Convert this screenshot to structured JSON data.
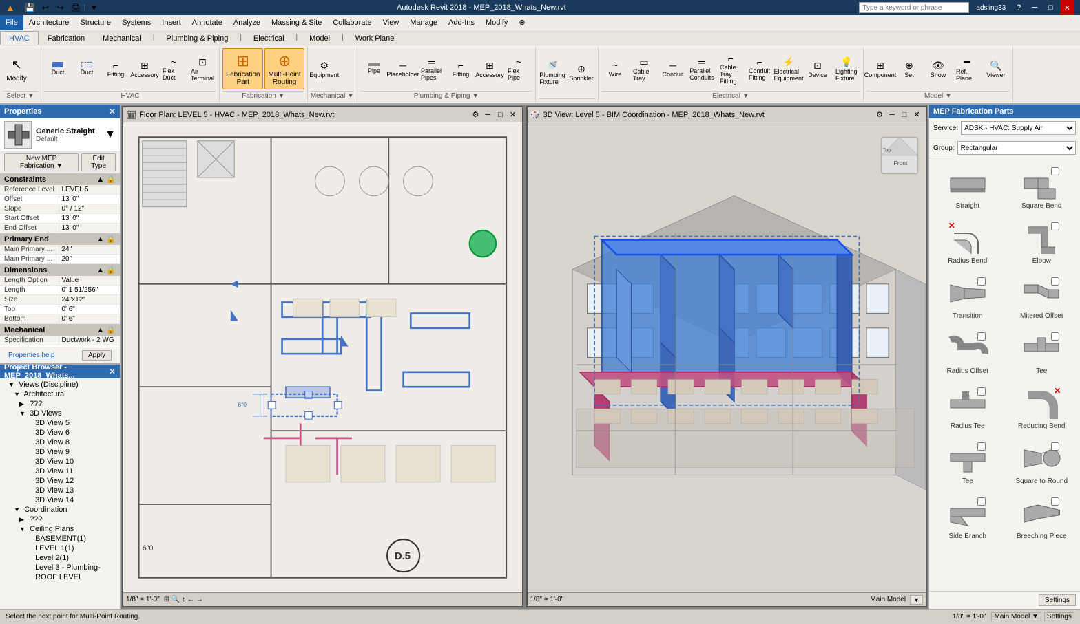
{
  "app": {
    "title": "Autodesk Revit 2018 - MEP_2018_Whats_New.rvt",
    "search_placeholder": "Type a keyword or phrase",
    "user": "adsiing33"
  },
  "title_bar": {
    "app_name": "Autodesk Revit 2018 - MEP_2018_Whats_New.rvt",
    "min": "─",
    "max": "□",
    "close": "✕"
  },
  "menu_bar": {
    "items": [
      "File",
      "Architecture",
      "Structure",
      "Systems",
      "Insert",
      "Annotate",
      "Analyze",
      "Massing & Site",
      "Collaborate",
      "View",
      "Manage",
      "Add-Ins",
      "Modify",
      "⊕"
    ]
  },
  "ribbon": {
    "tabs": [
      "HVAC",
      "Fabrication",
      "Mechanical",
      "Plumbing & Piping",
      "Electrical",
      "Model",
      "Work Plane"
    ],
    "hvac_buttons": [
      {
        "label": "Modify",
        "icon": "↖"
      },
      {
        "label": "Duct",
        "icon": "▬"
      },
      {
        "label": "Duct Placeholder",
        "icon": "▬"
      },
      {
        "label": "Duct Fitting",
        "icon": "⌐"
      },
      {
        "label": "Duct Accessory",
        "icon": "⊞"
      },
      {
        "label": "Duct Flex Duct",
        "icon": "~"
      },
      {
        "label": "Air Terminal",
        "icon": "⊡"
      },
      {
        "label": "Fabrication Part",
        "icon": "⊞"
      },
      {
        "label": "Multi-Point Routing",
        "icon": "⊕"
      },
      {
        "label": "Mechanical Equipment",
        "icon": "⚙"
      },
      {
        "label": "Pipe",
        "icon": "─"
      },
      {
        "label": "Pipe Placeholder",
        "icon": "─"
      },
      {
        "label": "Parallel Pipes",
        "icon": "═"
      },
      {
        "label": "Pipe Fitting",
        "icon": "⌐"
      },
      {
        "label": "Pipe Accessory",
        "icon": "⊞"
      },
      {
        "label": "Flex Pipe",
        "icon": "~"
      },
      {
        "label": "Plumbing Fixture",
        "icon": "🚿"
      },
      {
        "label": "Sprinkler",
        "icon": "⊕"
      },
      {
        "label": "Wire",
        "icon": "~"
      },
      {
        "label": "Cable Tray",
        "icon": "▭"
      },
      {
        "label": "Conduit",
        "icon": "─"
      },
      {
        "label": "Parallel Conduits",
        "icon": "═"
      },
      {
        "label": "Cable Tray Fitting",
        "icon": "⌐"
      },
      {
        "label": "Conduit Fitting",
        "icon": "⌐"
      },
      {
        "label": "Electrical Equipment",
        "icon": "⚡"
      },
      {
        "label": "Device",
        "icon": "⊡"
      },
      {
        "label": "Lighting Fixture",
        "icon": "💡"
      },
      {
        "label": "Component",
        "icon": "⊞"
      },
      {
        "label": "Set",
        "icon": "⊕"
      },
      {
        "label": "Show",
        "icon": "👁"
      },
      {
        "label": "Ref. Plane",
        "icon": "━"
      },
      {
        "label": "Viewer",
        "icon": "🔍"
      }
    ]
  },
  "properties": {
    "title": "Properties",
    "type": "Generic Straight",
    "subtype": "Default",
    "new_mep_btn": "New MEP Fabrication ▼",
    "edit_type_btn": "Edit Type",
    "sections": {
      "constraints": {
        "label": "Constraints",
        "fields": [
          {
            "label": "Reference Level",
            "value": "LEVEL 5"
          },
          {
            "label": "Offset",
            "value": "13' 0\""
          },
          {
            "label": "Slope",
            "value": "0° / 12\""
          },
          {
            "label": "Start Offset",
            "value": "13' 0\""
          },
          {
            "label": "End Offset",
            "value": "13' 0\""
          }
        ]
      },
      "primary_end": {
        "label": "Primary End",
        "fields": [
          {
            "label": "Main Primary ...",
            "value": "24\""
          },
          {
            "label": "Main Primary ...",
            "value": "20\""
          }
        ]
      },
      "dimensions": {
        "label": "Dimensions",
        "fields": [
          {
            "label": "Length Option",
            "value": "Value"
          },
          {
            "label": "Length",
            "value": "0' 1 51/256\""
          },
          {
            "label": "Size",
            "value": "24\"x12\""
          },
          {
            "label": "Top",
            "value": "0' 6\""
          },
          {
            "label": "Bottom",
            "value": "0' 6\""
          }
        ]
      },
      "mechanical": {
        "label": "Mechanical",
        "fields": [
          {
            "label": "Specification",
            "value": "Ductwork - 2 WG"
          }
        ]
      }
    },
    "properties_help": "Properties help",
    "apply_btn": "Apply"
  },
  "project_browser": {
    "title": "Project Browser - MEP_2018_Whats...",
    "tree": [
      {
        "level": 1,
        "icon": "▼",
        "label": "Views (Discipline)",
        "expanded": true
      },
      {
        "level": 2,
        "icon": "▼",
        "label": "Architectural",
        "expanded": true
      },
      {
        "level": 3,
        "icon": "▶",
        "label": "???",
        "expanded": false
      },
      {
        "level": 3,
        "icon": "▼",
        "label": "3D Views",
        "expanded": true
      },
      {
        "level": 4,
        "icon": "─",
        "label": "3D View 5"
      },
      {
        "level": 4,
        "icon": "─",
        "label": "3D View 6"
      },
      {
        "level": 4,
        "icon": "─",
        "label": "3D View 8"
      },
      {
        "level": 4,
        "icon": "─",
        "label": "3D View 9"
      },
      {
        "level": 4,
        "icon": "─",
        "label": "3D View 10"
      },
      {
        "level": 4,
        "icon": "─",
        "label": "3D View 11"
      },
      {
        "level": 4,
        "icon": "─",
        "label": "3D View 12"
      },
      {
        "level": 4,
        "icon": "─",
        "label": "3D View 13"
      },
      {
        "level": 4,
        "icon": "─",
        "label": "3D View 14"
      },
      {
        "level": 2,
        "icon": "▼",
        "label": "Coordination",
        "expanded": true
      },
      {
        "level": 3,
        "icon": "▶",
        "label": "???",
        "expanded": false
      },
      {
        "level": 3,
        "icon": "▼",
        "label": "Ceiling Plans",
        "expanded": true
      },
      {
        "level": 4,
        "icon": "─",
        "label": "BASEMENT(1)"
      },
      {
        "level": 4,
        "icon": "─",
        "label": "LEVEL 1(1)"
      },
      {
        "level": 4,
        "icon": "─",
        "label": "Level 2(1)"
      },
      {
        "level": 4,
        "icon": "─",
        "label": "Level 3 - Plumbing-"
      },
      {
        "level": 4,
        "icon": "─",
        "label": "ROOF LEVEL"
      }
    ]
  },
  "viewports": {
    "floor_plan": {
      "title": "Floor Plan: LEVEL 5 - HVAC - MEP_2018_Whats_New.rvt",
      "scale": "1/8\" = 1'-0\"",
      "label": "D.5"
    },
    "view_3d": {
      "title": "3D View: Level 5 - BIM Coordination - MEP_2018_Whats_New.rvt",
      "scale": "1/8\" = 1'-0\"",
      "model": "Main Model"
    }
  },
  "mep_fabrication": {
    "title": "MEP Fabrication Parts",
    "service_label": "Service:",
    "service_value": "ADSK - HVAC: Supply Air",
    "group_label": "Group:",
    "group_value": "Rectangular",
    "parts": [
      {
        "name": "Straight",
        "has_check": false,
        "checked": false
      },
      {
        "name": "Square Bend",
        "has_check": false,
        "checked": false
      },
      {
        "name": "Radius Bend",
        "has_check": false,
        "checked": false,
        "has_x": true
      },
      {
        "name": "Elbow",
        "has_check": false,
        "checked": false
      },
      {
        "name": "Transition",
        "has_check": false,
        "checked": false
      },
      {
        "name": "Mitered Offset",
        "has_check": false,
        "checked": false
      },
      {
        "name": "Radius Offset",
        "has_check": false,
        "checked": false
      },
      {
        "name": "Tee",
        "has_check": false,
        "checked": false
      },
      {
        "name": "Radius Tee",
        "has_check": false,
        "checked": false
      },
      {
        "name": "Reducing Bend",
        "has_check": false,
        "checked": false,
        "has_x": true
      },
      {
        "name": "Tee",
        "has_check": false,
        "checked": false
      },
      {
        "name": "Square to Round",
        "has_check": false,
        "checked": false
      },
      {
        "name": "Side Branch",
        "has_check": false,
        "checked": false
      },
      {
        "name": "Breeching Piece",
        "has_check": false,
        "checked": false
      }
    ]
  },
  "status_bar": {
    "message": "Select the next point for Multi-Point Routing.",
    "scale_items": [
      "1/8\" = 1'-0\""
    ],
    "model": "Main Model"
  },
  "bottom_toolbar": {
    "settings_btn": "Settings"
  },
  "colors": {
    "title_bar_bg": "#1a3a5c",
    "menu_bg": "#f0ede8",
    "ribbon_bg": "#f0ede8",
    "active_tab": "#1a5fa8",
    "panel_header": "#2e6aad",
    "duct_blue": "#4472c4",
    "duct_pink": "#c05080"
  }
}
